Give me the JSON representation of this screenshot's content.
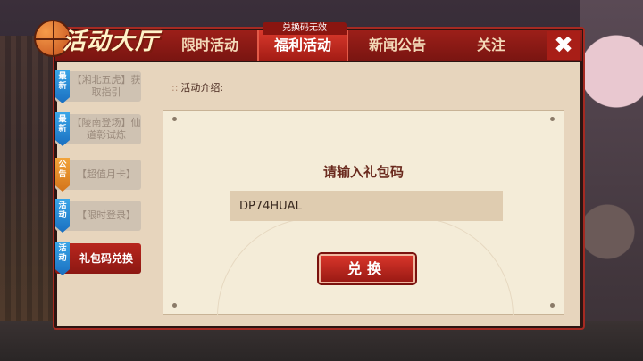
{
  "logo": {
    "title": "活动大厅"
  },
  "notice": "兑换码无效",
  "tabs": [
    {
      "label": "限时活动"
    },
    {
      "label": "福利活动"
    },
    {
      "label": "新闻公告"
    },
    {
      "label": "关注"
    }
  ],
  "close_symbol": "✖",
  "sidebar": {
    "items": [
      {
        "tag": "最新",
        "label": "【湘北五虎】获取指引",
        "tag_color": "blue"
      },
      {
        "tag": "最新",
        "label": "【陵南登场】仙道彰试炼",
        "tag_color": "blue"
      },
      {
        "tag": "公告",
        "label": "【超值月卡】",
        "tag_color": "orange"
      },
      {
        "tag": "活动",
        "label": "【限时登录】",
        "tag_color": "blue"
      },
      {
        "tag": "活动",
        "label": "礼包码兑换",
        "tag_color": "blue"
      }
    ]
  },
  "content": {
    "intro_label": "活动介绍:",
    "card_title": "请输入礼包码",
    "code_value": "DP74HUAL",
    "button_label": "兑换"
  },
  "colors": {
    "accent": "#a31c15",
    "panel": "#e7d5bd"
  }
}
